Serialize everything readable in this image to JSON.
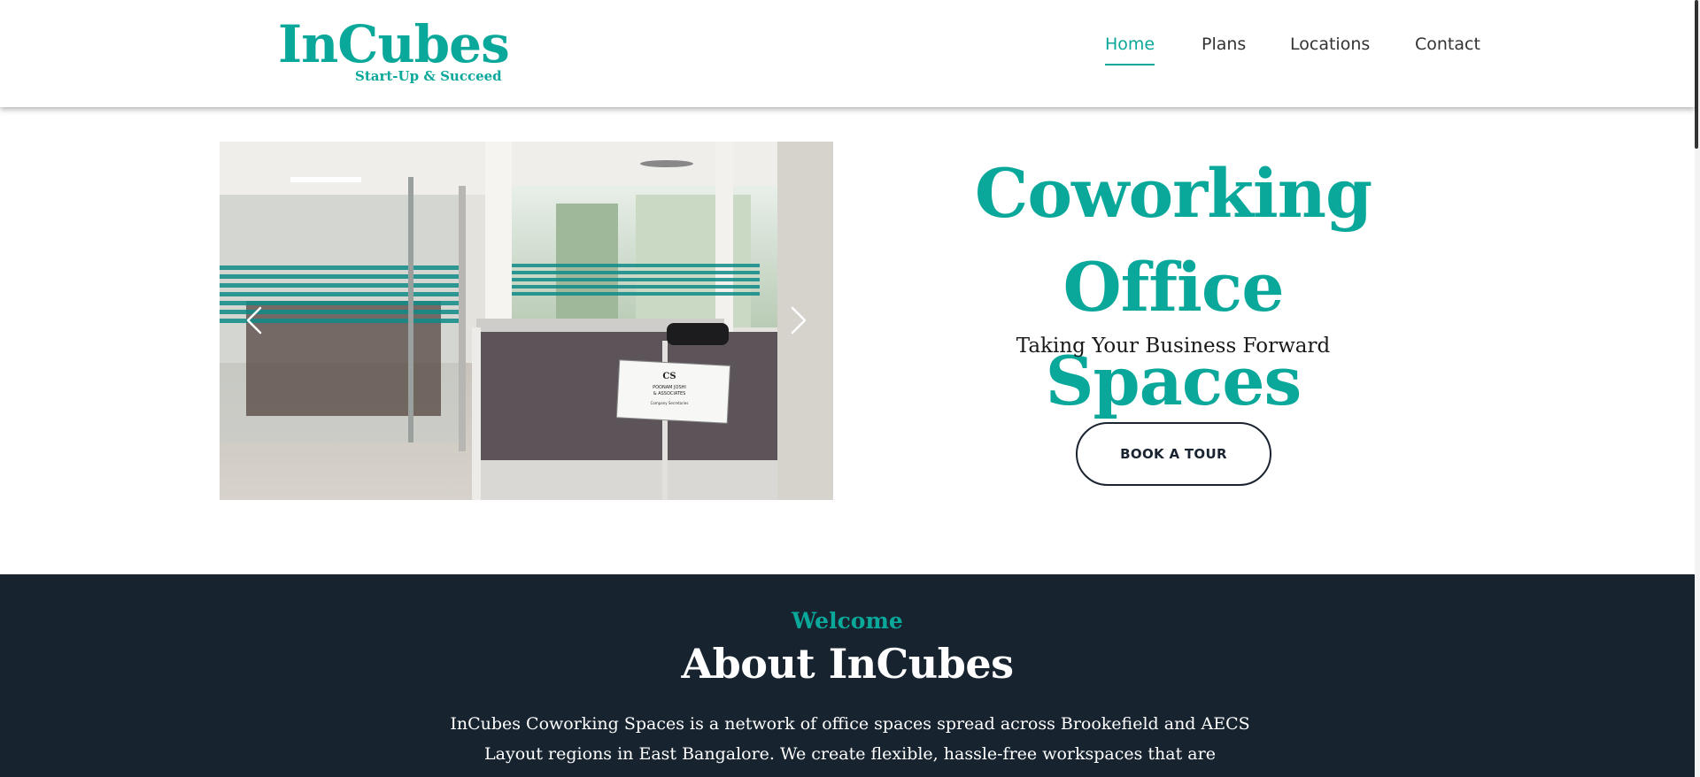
{
  "header": {
    "logo_name": "InCubes",
    "logo_tagline": "Start-Up & Succeed",
    "nav": [
      {
        "label": "Home",
        "active": true
      },
      {
        "label": "Plans",
        "active": false
      },
      {
        "label": "Locations",
        "active": false
      },
      {
        "label": "Contact",
        "active": false
      }
    ]
  },
  "carousel": {
    "slide_sign_lines": [
      "CS",
      "POONAM JOSHI",
      "& ASSOCIATES",
      "Company Secretaries"
    ],
    "prev_icon": "chevron-left-icon",
    "next_icon": "chevron-right-icon"
  },
  "hero": {
    "title_line1": "Coworking",
    "title_line2": "Office Spaces",
    "subtitle": "Taking Your Business Forward",
    "cta_label": "BOOK A TOUR"
  },
  "about": {
    "eyebrow": "Welcome",
    "title": "About InCubes",
    "body_line1": "InCubes Coworking Spaces is a network of office spaces spread across Brookefield and AECS",
    "body_line2": "Layout regions in East Bangalore. We create flexible, hassle-free workspaces that are"
  },
  "colors": {
    "accent": "#0aa89a",
    "dark_section": "#172430",
    "text_dark": "#1a2330"
  }
}
